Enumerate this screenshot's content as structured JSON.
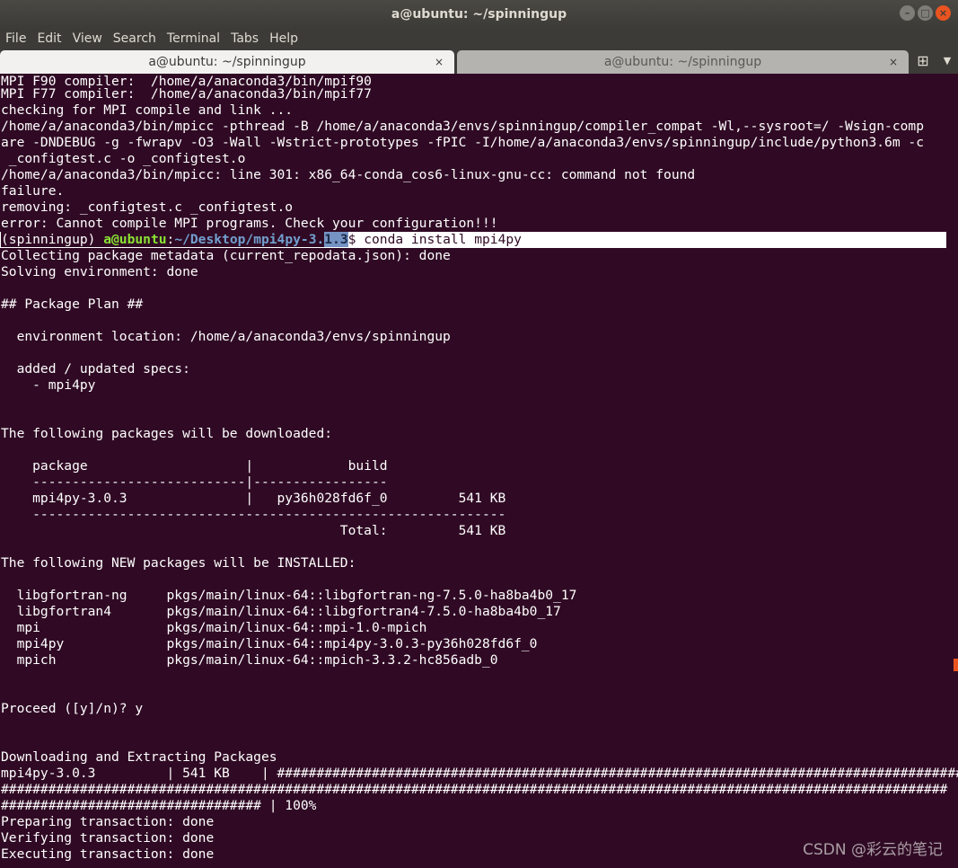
{
  "window": {
    "title": "a@ubuntu: ~/spinningup",
    "minimize_glyph": "–",
    "maximize_glyph": "□",
    "close_glyph": "×"
  },
  "menu": [
    "File",
    "Edit",
    "View",
    "Search",
    "Terminal",
    "Tabs",
    "Help"
  ],
  "tabs": [
    {
      "label": "a@ubuntu: ~/spinningup",
      "close": "×"
    },
    {
      "label": "a@ubuntu: ~/spinningup",
      "close": "×"
    }
  ],
  "tab_controls": {
    "new_tab_glyph": "⊞",
    "dropdown_glyph": "▼"
  },
  "terminal": {
    "lines_before": [
      "MPI F90 compiler:  /home/a/anaconda3/bin/mpif90",
      "MPI F77 compiler:  /home/a/anaconda3/bin/mpif77",
      "checking for MPI compile and link ...",
      "/home/a/anaconda3/bin/mpicc -pthread -B /home/a/anaconda3/envs/spinningup/compiler_compat -Wl,--sysroot=/ -Wsign-comp",
      "are -DNDEBUG -g -fwrapv -O3 -Wall -Wstrict-prototypes -fPIC -I/home/a/anaconda3/envs/spinningup/include/python3.6m -c",
      " _configtest.c -o _configtest.o",
      "/home/a/anaconda3/bin/mpicc: line 301: x86_64-conda_cos6-linux-gnu-cc: command not found",
      "failure.",
      "removing: _configtest.c _configtest.o",
      "error: Cannot compile MPI programs. Check your configuration!!!"
    ],
    "prompt": {
      "env": "(spinningup) ",
      "user_host": "a@ubuntu",
      "colon": ":",
      "path": "~/Desktop/mpi4py-3.",
      "path_selected": "1.3",
      "dollar": "$",
      "command": " conda install mpi4py"
    },
    "lines_after": [
      "Collecting package metadata (current_repodata.json): done",
      "Solving environment: done",
      "",
      "## Package Plan ##",
      "",
      "  environment location: /home/a/anaconda3/envs/spinningup",
      "",
      "  added / updated specs:",
      "    - mpi4py",
      "",
      "",
      "The following packages will be downloaded:",
      "",
      "    package                    |            build",
      "    ---------------------------|-----------------",
      "    mpi4py-3.0.3               |   py36h028fd6f_0         541 KB",
      "    ------------------------------------------------------------",
      "                                           Total:         541 KB",
      "",
      "The following NEW packages will be INSTALLED:",
      "",
      "  libgfortran-ng     pkgs/main/linux-64::libgfortran-ng-7.5.0-ha8ba4b0_17",
      "  libgfortran4       pkgs/main/linux-64::libgfortran4-7.5.0-ha8ba4b0_17",
      "  mpi                pkgs/main/linux-64::mpi-1.0-mpich",
      "  mpi4py             pkgs/main/linux-64::mpi4py-3.0.3-py36h028fd6f_0",
      "  mpich              pkgs/main/linux-64::mpich-3.3.2-hc856adb_0",
      "",
      "",
      "Proceed ([y]/n)? y",
      "",
      "",
      "Downloading and Extracting Packages",
      "mpi4py-3.0.3         | 541 KB    | #######################################################################################",
      "########################################################################################################################",
      "################################# | 100%",
      "Preparing transaction: done",
      "Verifying transaction: done",
      "Executing transaction: done"
    ]
  },
  "watermark": "CSDN @彩云的笔记"
}
